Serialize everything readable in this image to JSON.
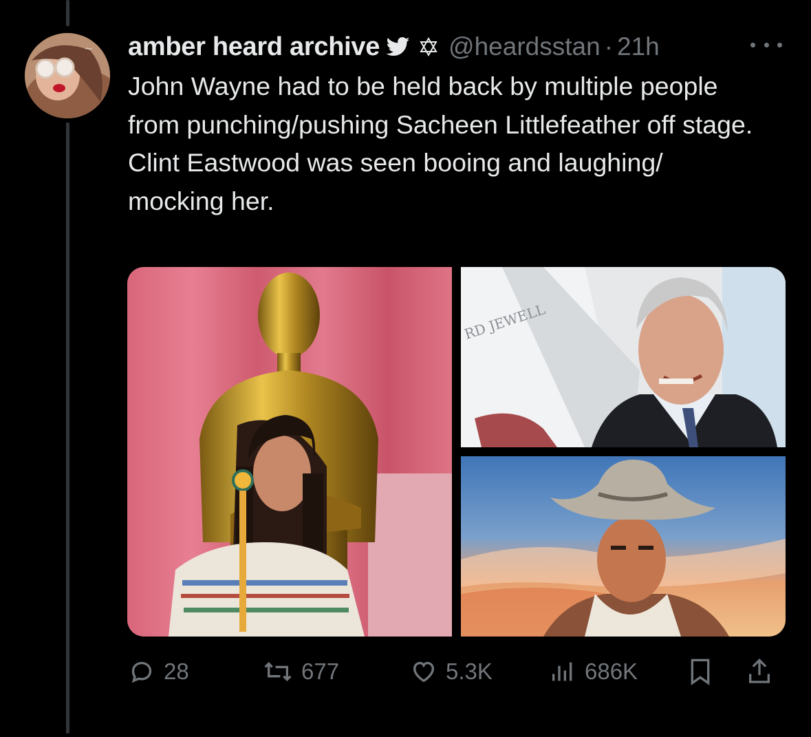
{
  "tweet": {
    "display_name": "amber heard archive",
    "handle": "@heardsstan",
    "separator": "·",
    "time": "21h",
    "text_lines": [
      "John Wayne had to be held back by multiple people from punching/pushing Sacheen Littlefeather off stage.",
      "Clint Eastwood was seen booing and laughing/ mocking her."
    ],
    "image_text": {
      "poster_text": "RD JEWELL"
    }
  },
  "actions": {
    "replies": "28",
    "retweets": "677",
    "likes": "5.3K",
    "views": "686K"
  },
  "icons": {
    "verified": "bird-icon",
    "badge": "star-of-david-icon",
    "more": "more-options-icon",
    "reply": "reply-icon",
    "retweet": "retweet-icon",
    "like": "heart-icon",
    "views": "analytics-icon",
    "bookmark": "bookmark-icon",
    "share": "share-icon"
  },
  "colors": {
    "background": "#000000",
    "text": "#e7e9ea",
    "muted": "#71767b",
    "thread_line": "#333639"
  }
}
